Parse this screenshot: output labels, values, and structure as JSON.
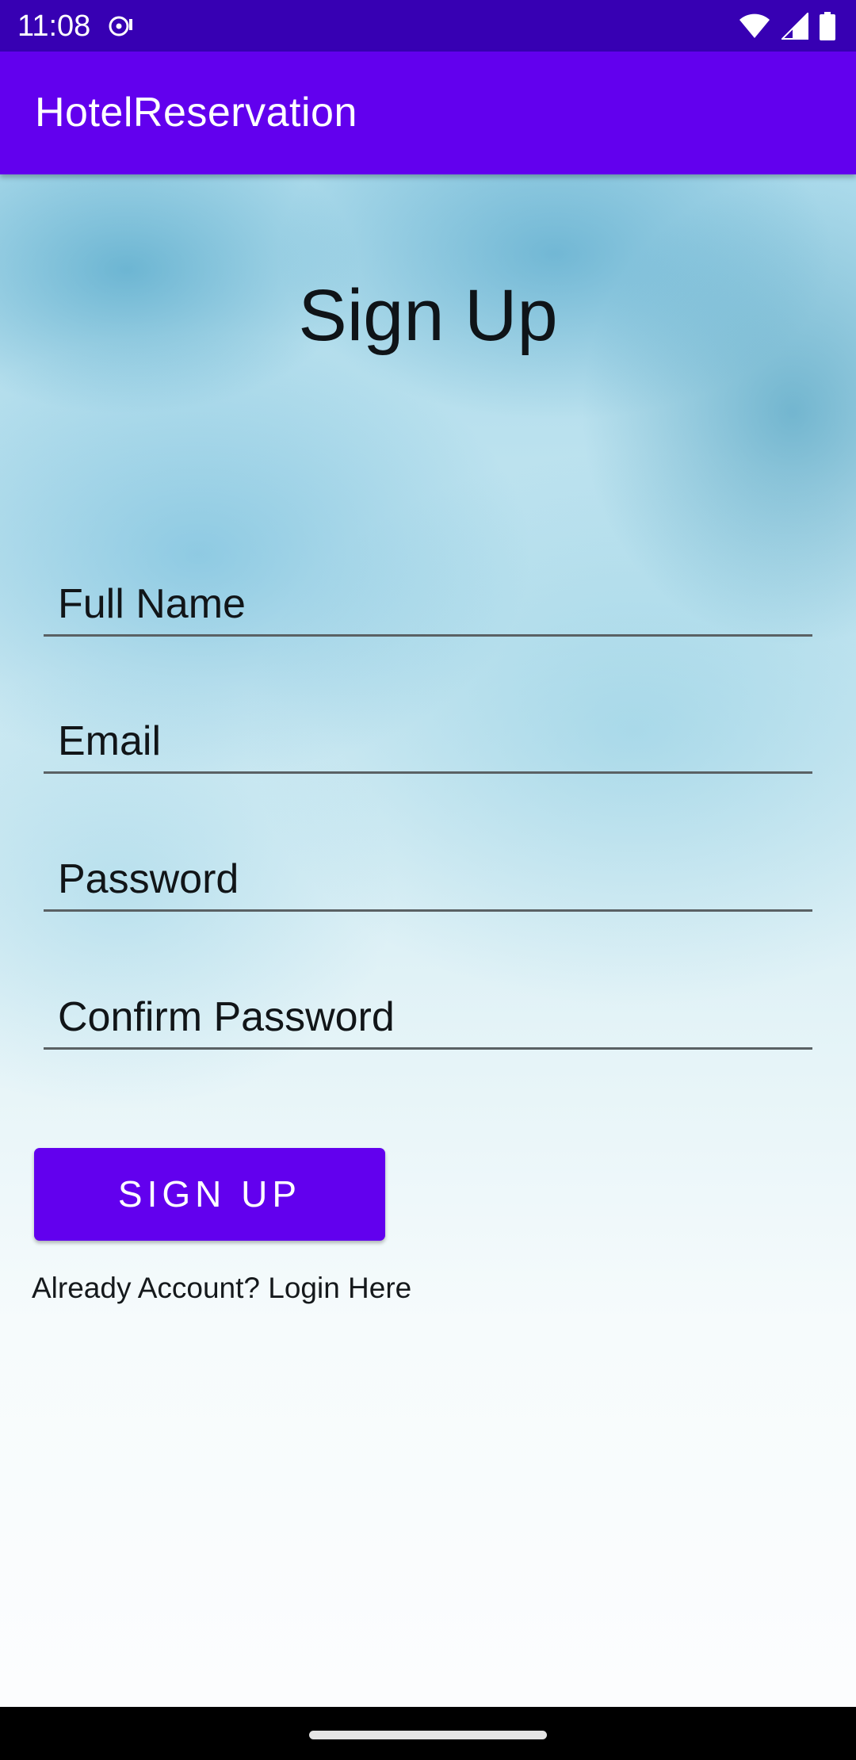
{
  "status_bar": {
    "time": "11:08",
    "icons": [
      "media-icon",
      "wifi-icon",
      "signal-icon",
      "battery-icon"
    ]
  },
  "app_bar": {
    "title": "HotelReservation"
  },
  "form": {
    "title": "Sign Up",
    "fields": [
      {
        "placeholder": "Full Name"
      },
      {
        "placeholder": "Email"
      },
      {
        "placeholder": "Password"
      },
      {
        "placeholder": "Confirm Password"
      }
    ],
    "submit_label": "SIGN UP",
    "login_link": "Already Account? Login Here"
  },
  "colors": {
    "status_bar": "#3700b3",
    "primary": "#6200ee",
    "text": "#111518"
  }
}
